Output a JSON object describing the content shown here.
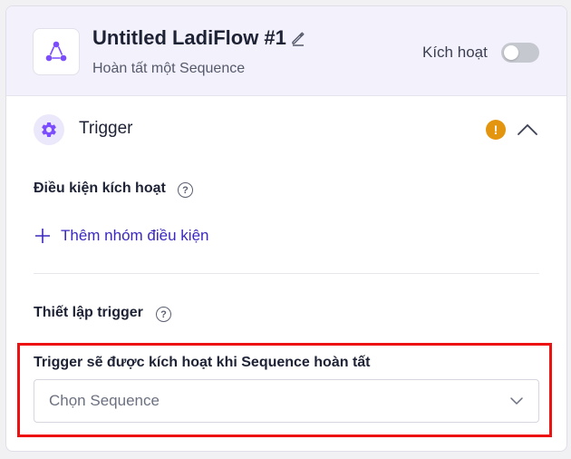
{
  "header": {
    "title": "Untitled LadiFlow #1",
    "subtitle": "Hoàn tất một Sequence",
    "activate_label": "Kích hoạt",
    "activate_on": false,
    "logo_icon": "share-nodes-icon",
    "edit_icon": "pencil-icon"
  },
  "trigger": {
    "title": "Trigger",
    "icon": "gear-icon",
    "status_icon": "warning-icon",
    "collapse_icon": "chevron-up-icon",
    "conditions": {
      "label": "Điều kiện kích hoạt",
      "add_group_label": "Thêm nhóm điều kiện"
    },
    "setup": {
      "label": "Thiết lập trigger",
      "field_label": "Trigger sẽ được kích hoạt khi Sequence hoàn tất",
      "select_placeholder": "Chọn Sequence"
    }
  },
  "colors": {
    "accent": "#7c4dff",
    "link": "#3a28c0",
    "warning": "#e4950f",
    "highlight": "#ee1111",
    "header_bg": "#f3f1fb"
  }
}
